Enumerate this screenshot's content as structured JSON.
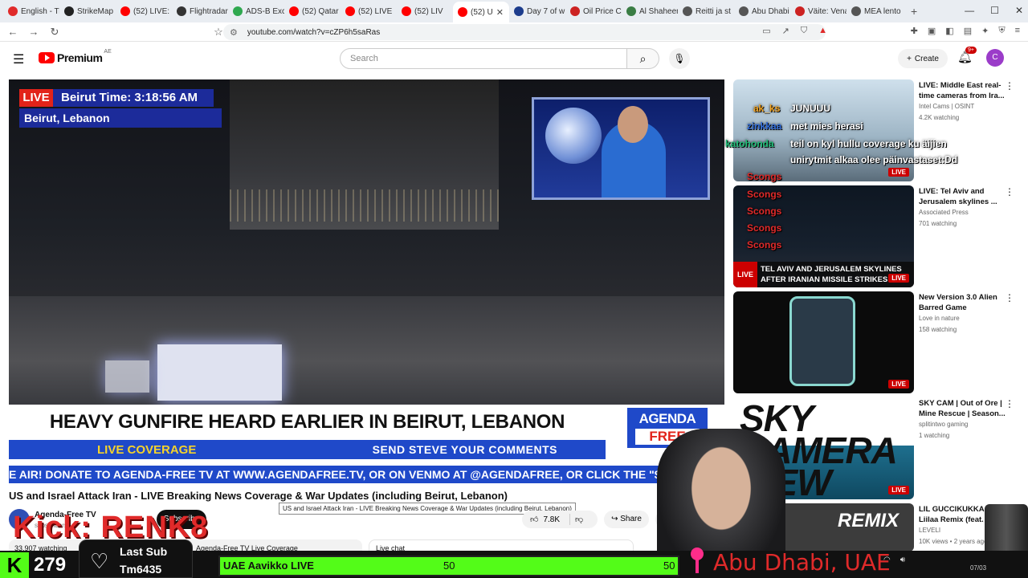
{
  "browser": {
    "tabs": [
      {
        "label": "English - Tr",
        "color": "#e02a2a"
      },
      {
        "label": "StrikeMap",
        "color": "#222222"
      },
      {
        "label": "(52) LIVE: K",
        "color": "#ff0000"
      },
      {
        "label": "Flightradar",
        "color": "#333333"
      },
      {
        "label": "ADS-B Exc",
        "color": "#2fa84f"
      },
      {
        "label": "(52) Qatar",
        "color": "#ff0000"
      },
      {
        "label": "(52) LIVE",
        "color": "#ff0000"
      },
      {
        "label": "(52) LIV",
        "color": "#ff0000"
      },
      {
        "label": "(52) U",
        "color": "#ff0000",
        "active": true
      },
      {
        "label": "Day 7 of w",
        "color": "#1c3c8c"
      },
      {
        "label": "Oil Price C",
        "color": "#cc2222"
      },
      {
        "label": "Al Shaheen",
        "color": "#3a7d44"
      },
      {
        "label": "Reitti ja st",
        "color": "#555555"
      },
      {
        "label": "Abu Dhabi",
        "color": "#555555"
      },
      {
        "label": "Väite: Vena",
        "color": "#cc2222"
      },
      {
        "label": "MEA lento",
        "color": "#555555"
      }
    ],
    "url": "youtube.com/watch?v=cZP6h5saRas"
  },
  "youtube": {
    "logo_word": "Premium",
    "country_code": "AE",
    "search_placeholder": "Search",
    "create_label": "Create",
    "notif_badge": "9+",
    "avatar_letter": "C"
  },
  "video": {
    "live_tag": "LIVE",
    "time_label": "Beirut Time: 3:18:56 AM",
    "location_label": "Beirut, Lebanon",
    "headline": "HEAVY GUNFIRE HEARD EARLIER IN BEIRUT, LEBANON",
    "live_coverage": "LIVE COVERAGE",
    "send_comments": "SEND STEVE YOUR COMMENTS",
    "logo_top": "AGENDA",
    "logo_bottom": "FREE",
    "ticker": "E AIR! DONATE TO AGENDA-FREE TV AT WWW.AGENDAFREE.TV, OR ON VENMO AT @AGENDAFREE, OR CLICK THE \"$\" BUTTON AT T"
  },
  "meta": {
    "title": "US and Israel Attack Iran - LIVE Breaking News Coverage & War Updates (including Beirut, Lebanon)",
    "tooltip": "US and Israel Attack Iran - LIVE Breaking News Coverage & War Updates (including Beirut, Lebanon)",
    "channel": "Agenda-Free TV",
    "subscribers": "subscribers",
    "subscribe": "Subscribe",
    "likes": "7.8K",
    "share": "Share",
    "views": "33,907 watching",
    "desc_channel": "Agenda-Free TV Live Coverage",
    "chat_title": "Live chat"
  },
  "recommendations": [
    {
      "title": "LIVE: Middle East real-time cameras from Ira...",
      "channel": "Intel Cams | OSINT",
      "views": "4.2K watching",
      "badge": "LIVE"
    },
    {
      "title": "LIVE: Tel Aviv and Jerusalem skylines ...",
      "channel": "Associated Press",
      "views": "701 watching",
      "badge": "LIVE",
      "banner": "TEL AVIV AND JERUSALEM SKYLINES AFTER IRANIAN MISSILE STRIKES"
    },
    {
      "title": "New Version 3.0 Alien Barred Game",
      "channel": "Love in nature",
      "views": "158 watching",
      "badge": "LIVE"
    },
    {
      "title": "SKY CAM | Out of Ore | Mine Rescue | Season...",
      "channel": "splitintwo gaming",
      "views": "1 watching",
      "badge": "LIVE",
      "thumb_text": "SKY CAMERA VIEW"
    },
    {
      "title": "LIL GUCCIKUKKA - Liilaa Remix (feat. ...",
      "channel": "LEVELI",
      "views": "10K views • 2 years ago",
      "thumb_text": "REMIX"
    }
  ],
  "chat_overlay": [
    {
      "user": "ak_ks",
      "text": "JUNUUU",
      "color": "#f5a623"
    },
    {
      "user": "zinkkaa",
      "text": "met mies herasi",
      "color": "#2f6bd8"
    },
    {
      "user": "katohonda",
      "text": "teil on kyl hullu coverage ku äijien",
      "color": "#22c07a"
    },
    {
      "user": "",
      "text": "unirytmit alkaa olee päinvastaset:Dd",
      "color": "#ffffff"
    },
    {
      "user": "Scongs",
      "text": "",
      "color": "#e02a2a"
    }
  ],
  "stream_overlay": {
    "kick_text": "Kick: RENK8",
    "kick_letter": "K",
    "viewer_count": "279",
    "last_sub_label": "Last Sub",
    "last_sub_name": "Tm6435",
    "poll_title": "UAE Aavikko LIVE",
    "poll_value_1": "50",
    "poll_value_2": "50",
    "location": "Abu Dhabi, UAE",
    "date": "07/03"
  }
}
